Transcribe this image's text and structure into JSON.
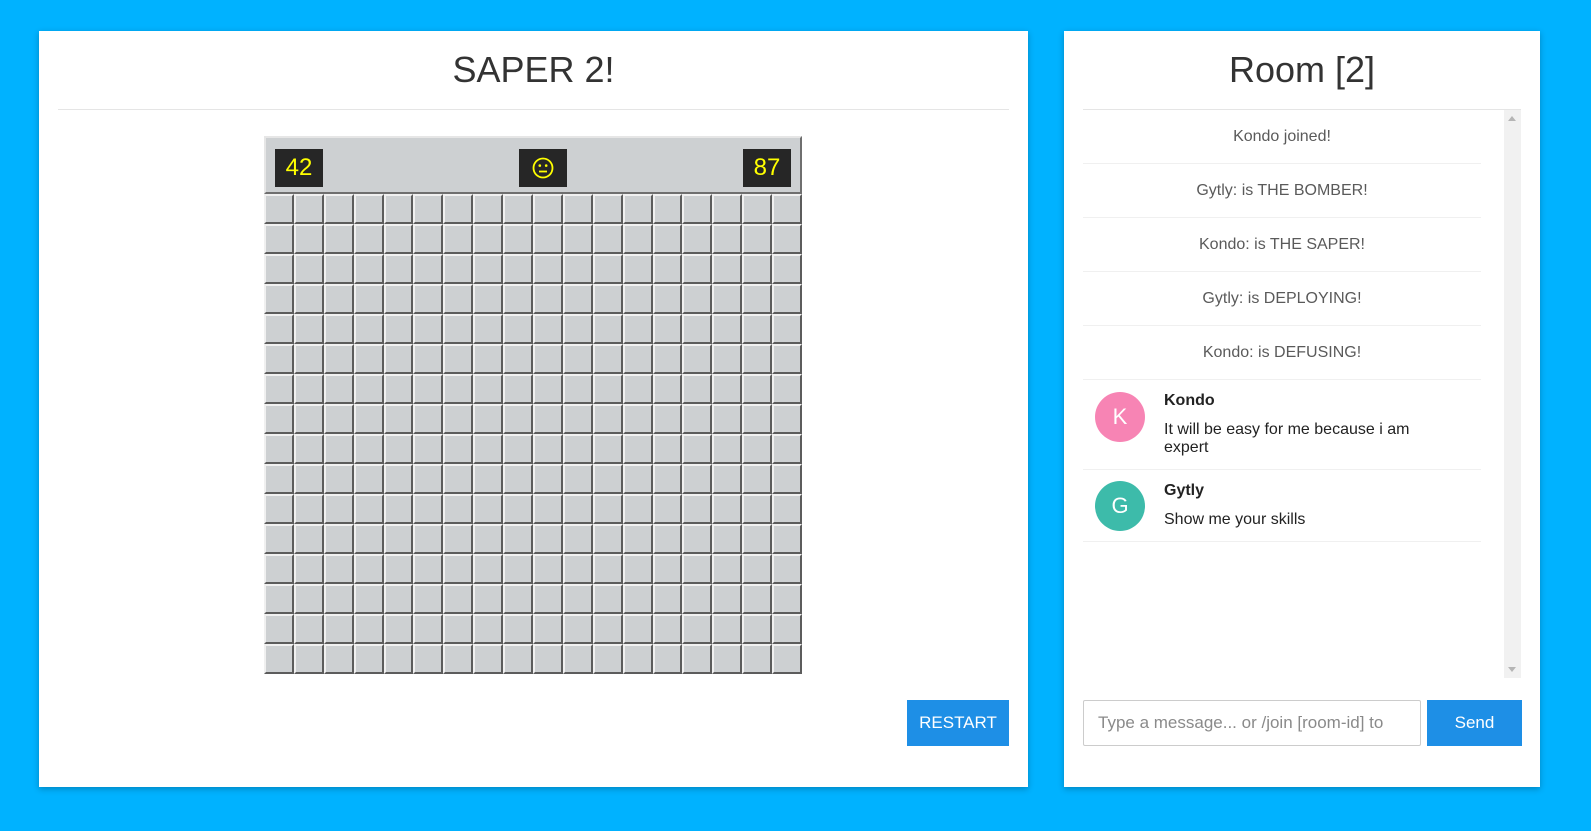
{
  "game": {
    "title": "SAPER 2!",
    "mines_counter": "42",
    "face": "neutral-face",
    "timer_counter": "87",
    "grid": {
      "columns": 18,
      "rows": 16
    },
    "restart_label": "RESTART"
  },
  "chat": {
    "title": "Room [2]",
    "system_messages": [
      "Kondo joined!",
      "Gytly: is THE BOMBER!",
      "Kondo: is THE SAPER!",
      "Gytly: is DEPLOYING!",
      "Kondo: is DEFUSING!"
    ],
    "messages": [
      {
        "author": "Kondo",
        "initial": "K",
        "text": "It will be easy for me because i am expert",
        "avatar_color": "#f784b4"
      },
      {
        "author": "Gytly",
        "initial": "G",
        "text": "Show me your skills",
        "avatar_color": "#3dbbaa"
      }
    ],
    "input_placeholder": "Type a message... or /join [room-id] to",
    "send_label": "Send"
  },
  "colors": {
    "background": "#00b2ff",
    "button": "#1e8fe6",
    "counter_text": "#ffff00",
    "counter_bg": "#262626",
    "cell": "#cdd0d2"
  }
}
